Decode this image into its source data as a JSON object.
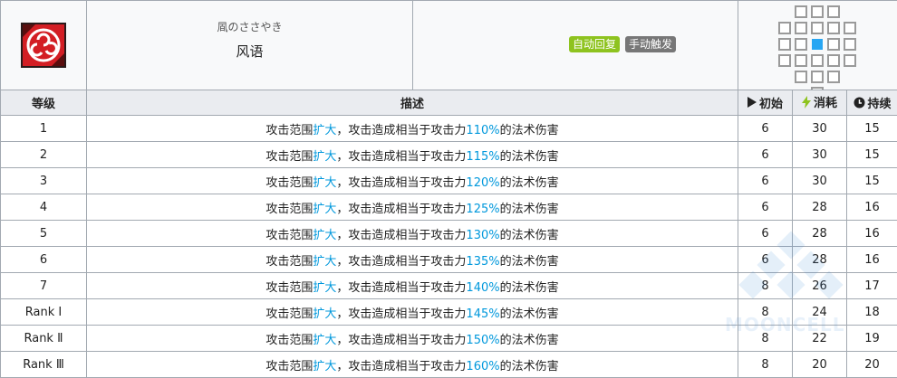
{
  "skill": {
    "jp_name": "凮のささやき",
    "cn_name": "风语",
    "icon": "wind-triskelion-icon",
    "tags": [
      "自动回复",
      "手动触发"
    ]
  },
  "range": {
    "grid_cols": 5,
    "grid_rows": 6,
    "active_cells": [
      [
        1,
        0
      ],
      [
        2,
        0
      ],
      [
        3,
        0
      ],
      [
        0,
        1
      ],
      [
        1,
        1
      ],
      [
        2,
        1
      ],
      [
        3,
        1
      ],
      [
        4,
        1
      ],
      [
        0,
        2
      ],
      [
        1,
        2
      ],
      [
        3,
        2
      ],
      [
        4,
        2
      ],
      [
        0,
        3
      ],
      [
        1,
        3
      ],
      [
        2,
        3
      ],
      [
        3,
        3
      ],
      [
        4,
        3
      ],
      [
        1,
        4
      ],
      [
        2,
        4
      ],
      [
        3,
        4
      ],
      [
        2,
        5
      ]
    ],
    "center_cell": [
      2,
      2
    ],
    "center_color": "#27a6f3"
  },
  "columns": {
    "level": "等级",
    "desc": "描述",
    "initial": "初始",
    "cost": "消耗",
    "duration": "持续"
  },
  "desc_parts": {
    "prefix": "攻击范围",
    "highlight": "扩大",
    "middle": "，攻击造成相当于攻击力",
    "suffix": "的法术伤害"
  },
  "rows": [
    {
      "level": "1",
      "pct": "110%",
      "initial": "6",
      "cost": "30",
      "duration": "15"
    },
    {
      "level": "2",
      "pct": "115%",
      "initial": "6",
      "cost": "30",
      "duration": "15"
    },
    {
      "level": "3",
      "pct": "120%",
      "initial": "6",
      "cost": "30",
      "duration": "15"
    },
    {
      "level": "4",
      "pct": "125%",
      "initial": "6",
      "cost": "28",
      "duration": "16"
    },
    {
      "level": "5",
      "pct": "130%",
      "initial": "6",
      "cost": "28",
      "duration": "16"
    },
    {
      "level": "6",
      "pct": "135%",
      "initial": "6",
      "cost": "28",
      "duration": "16"
    },
    {
      "level": "7",
      "pct": "140%",
      "initial": "8",
      "cost": "26",
      "duration": "17"
    },
    {
      "level": "Rank Ⅰ",
      "pct": "145%",
      "initial": "8",
      "cost": "24",
      "duration": "18"
    },
    {
      "level": "Rank Ⅱ",
      "pct": "150%",
      "initial": "8",
      "cost": "22",
      "duration": "19"
    },
    {
      "level": "Rank Ⅲ",
      "pct": "160%",
      "initial": "8",
      "cost": "20",
      "duration": "20"
    }
  ],
  "watermark": "MOONCELL",
  "colors": {
    "highlight": "#0098dc",
    "tag_recovery": "#8ec31f",
    "tag_trigger": "#777777",
    "sp_icon": "#8ec31f"
  }
}
